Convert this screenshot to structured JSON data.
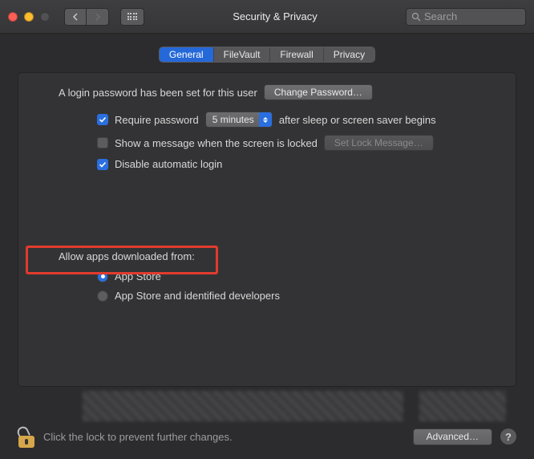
{
  "window": {
    "title": "Security & Privacy",
    "search_placeholder": "Search"
  },
  "tabs": {
    "general": "General",
    "filevault": "FileVault",
    "firewall": "Firewall",
    "privacy": "Privacy"
  },
  "login": {
    "status_text": "A login password has been set for this user",
    "change_btn": "Change Password…",
    "require_label": "Require password",
    "require_delay": "5 minutes",
    "require_suffix": "after sleep or screen saver begins",
    "show_message_label": "Show a message when the screen is locked",
    "set_lock_btn": "Set Lock Message…",
    "disable_auto_label": "Disable automatic login"
  },
  "download": {
    "section_label": "Allow apps downloaded from:",
    "opt_appstore": "App Store",
    "opt_identified": "App Store and identified developers"
  },
  "footer": {
    "lock_text": "Click the lock to prevent further changes.",
    "advanced_btn": "Advanced…",
    "help": "?"
  }
}
